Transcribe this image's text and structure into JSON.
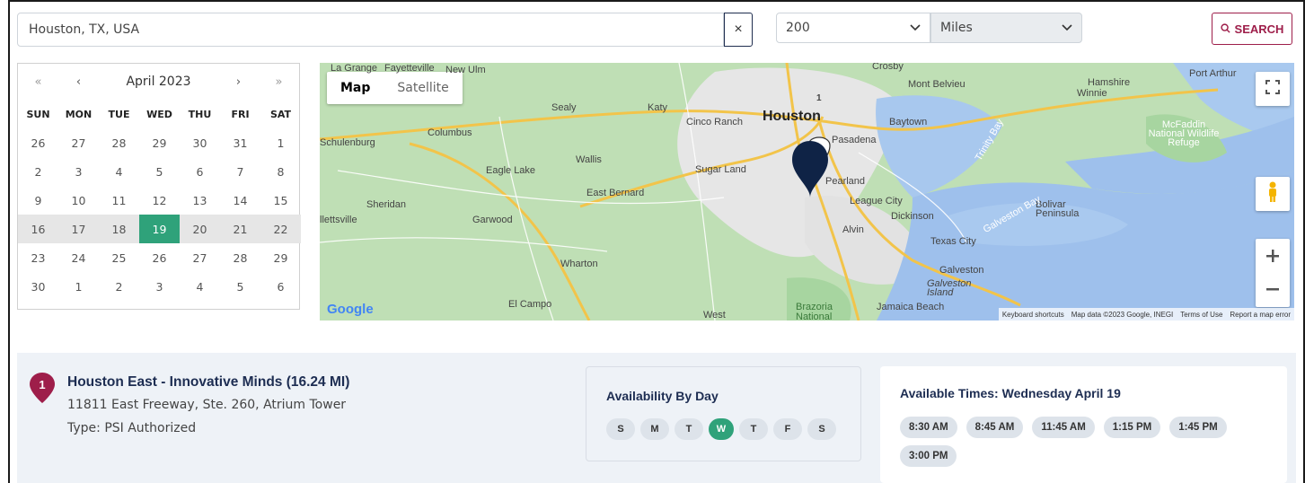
{
  "search": {
    "location_value": "Houston, TX, USA",
    "clear_label": "×"
  },
  "radius": {
    "value": "200",
    "unit": "Miles"
  },
  "search_button": {
    "label": "SEARCH"
  },
  "calendar": {
    "month_title": "April 2023",
    "nav": {
      "prev_year": "«",
      "prev_month": "‹",
      "next_month": "›",
      "next_year": "»"
    },
    "dow": [
      "SUN",
      "MON",
      "TUE",
      "WED",
      "THU",
      "FRI",
      "SAT"
    ],
    "weeks": [
      [
        "26",
        "27",
        "28",
        "29",
        "30",
        "31",
        "1"
      ],
      [
        "2",
        "3",
        "4",
        "5",
        "6",
        "7",
        "8"
      ],
      [
        "9",
        "10",
        "11",
        "12",
        "13",
        "14",
        "15"
      ],
      [
        "16",
        "17",
        "18",
        "19",
        "20",
        "21",
        "22"
      ],
      [
        "23",
        "24",
        "25",
        "26",
        "27",
        "28",
        "29"
      ],
      [
        "30",
        "1",
        "2",
        "3",
        "4",
        "5",
        "6"
      ]
    ],
    "selected": "19"
  },
  "map": {
    "type_map": "Map",
    "type_satellite": "Satellite",
    "labels": {
      "la_grange": "La Grange",
      "fayetteville": "Fayetteville",
      "new_ulm": "New Ulm",
      "sealy": "Sealy",
      "katy": "Katy",
      "cinco_ranch": "Cinco Ranch",
      "houston": "Houston",
      "pasadena": "Pasadena",
      "baytown": "Baytown",
      "mont_belvieu": "Mont Belvieu",
      "hamshire": "Hamshire",
      "winnie": "Winnie",
      "port_arthur": "Port Arthur",
      "schulenburg": "Schulenburg",
      "columbus": "Columbus",
      "wallis": "Wallis",
      "eagle_lake": "Eagle Lake",
      "sugar_land": "Sugar Land",
      "pearland": "Pearland",
      "east_bernard": "East Bernard",
      "sheridan": "Sheridan",
      "garwood": "Garwood",
      "hallettsville": "llettsville",
      "league_city": "League City",
      "dickinson": "Dickinson",
      "alvin": "Alvin",
      "texas_city": "Texas City",
      "galveston": "Galveston",
      "galveston_island": "Galveston Island",
      "wharton": "Wharton",
      "el_campo": "El Campo",
      "west": "West",
      "brazoria": "Brazoria National",
      "jamaica_beach": "Jamaica Beach",
      "bolivar": "Bolivar Peninsula",
      "mcfaddin": "McFaddin National Wildlife Refuge",
      "trinity_bay": "Trinity Bay",
      "galveston_bay": "Galveston Bay",
      "crosby": "Crosby"
    },
    "marker_number": "1",
    "footer": {
      "shortcuts": "Keyboard shortcuts",
      "map_data": "Map data ©2023 Google, INEGI",
      "terms": "Terms of Use",
      "report": "Report a map error"
    },
    "logo": "Google"
  },
  "result": {
    "number": "1",
    "title": "Houston East - Innovative Minds (16.24 MI)",
    "address": "11811 East Freeway, Ste. 260, Atrium Tower",
    "type": "Type: PSI Authorized",
    "availability_title": "Availability By Day",
    "days": [
      "S",
      "M",
      "T",
      "W",
      "T",
      "F",
      "S"
    ],
    "active_day": "W",
    "times_title": "Available Times: Wednesday April 19",
    "times": [
      "8:30 AM",
      "8:45 AM",
      "11:45 AM",
      "1:15 PM",
      "1:45 PM",
      "3:00 PM"
    ]
  },
  "colors": {
    "accent_green": "#2fa27a",
    "brand_maroon": "#9e1e4a",
    "navy": "#1d2d52"
  }
}
